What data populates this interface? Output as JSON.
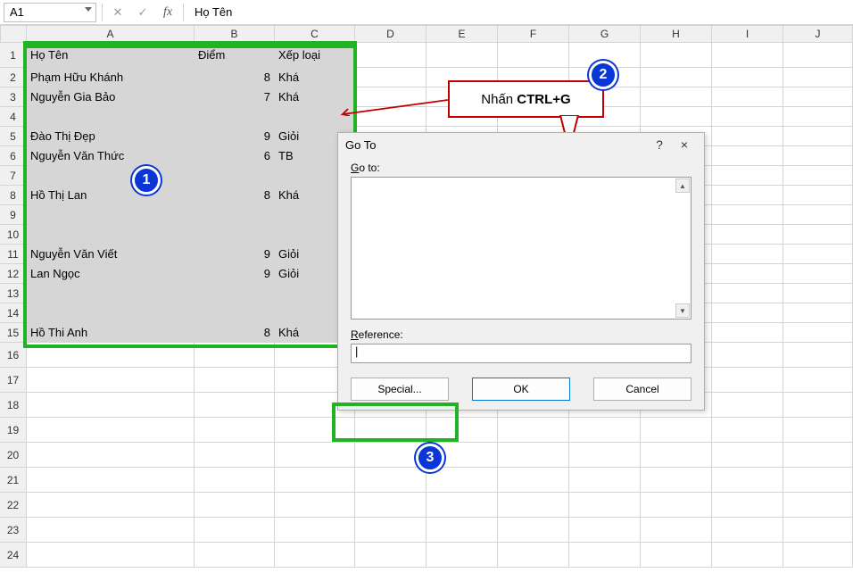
{
  "formula_bar": {
    "name_box": "A1",
    "cancel_glyph": "✕",
    "enter_glyph": "✓",
    "fx_glyph": "fx",
    "value": "Họ Tên"
  },
  "columns": [
    "A",
    "B",
    "C",
    "D",
    "E",
    "F",
    "G",
    "H",
    "I",
    "J"
  ],
  "row_numbers": [
    "1",
    "2",
    "3",
    "4",
    "5",
    "6",
    "7",
    "8",
    "9",
    "10",
    "11",
    "12",
    "13",
    "14",
    "15",
    "16",
    "17",
    "18",
    "19",
    "20",
    "21",
    "22",
    "23",
    "24"
  ],
  "cells": {
    "r1": {
      "a": "Họ Tên",
      "b": "Điểm",
      "c": "Xếp loại"
    },
    "r2": {
      "a": "Phạm Hữu Khánh",
      "b": "8",
      "c": "Khá"
    },
    "r3": {
      "a": "Nguyễn Gia Bảo",
      "b": "7",
      "c": "Khá"
    },
    "r4": {
      "a": "",
      "b": "",
      "c": ""
    },
    "r5": {
      "a": "Đào Thị Đẹp",
      "b": "9",
      "c": "Giỏi"
    },
    "r6": {
      "a": "Nguyễn Văn Thức",
      "b": "6",
      "c": "TB"
    },
    "r7": {
      "a": "",
      "b": "",
      "c": ""
    },
    "r8": {
      "a": "Hồ Thị Lan",
      "b": "8",
      "c": "Khá"
    },
    "r9": {
      "a": "",
      "b": "",
      "c": ""
    },
    "r10": {
      "a": "",
      "b": "",
      "c": ""
    },
    "r11": {
      "a": "Nguyễn Văn Viết",
      "b": "9",
      "c": "Giỏi"
    },
    "r12": {
      "a": "Lan Ngọc",
      "b": "9",
      "c": "Giỏi"
    },
    "r13": {
      "a": "",
      "b": "",
      "c": ""
    },
    "r14": {
      "a": "",
      "b": "",
      "c": ""
    },
    "r15": {
      "a": "Hồ Thi Anh",
      "b": "8",
      "c": "Khá"
    }
  },
  "dialog": {
    "title": "Go To",
    "help_glyph": "?",
    "close_glyph": "×",
    "goto_label": "Go to:",
    "reference_label": "Reference:",
    "reference_value": "|",
    "special_btn": "Special...",
    "ok_btn": "OK",
    "cancel_btn": "Cancel"
  },
  "callout": {
    "prefix": "Nhấn ",
    "bold": "CTRL+G"
  },
  "badges": {
    "b1": "1",
    "b2": "2",
    "b3": "3"
  }
}
